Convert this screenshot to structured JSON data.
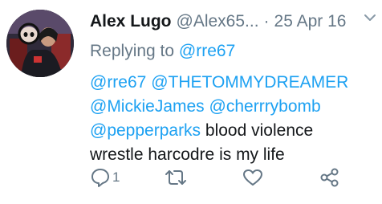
{
  "tweet": {
    "author_name": "Alex Lugo",
    "author_handle": "@Alex65...",
    "separator": "·",
    "timestamp": "25 Apr 16",
    "replying_prefix": "Replying to",
    "replying_to": "@rre67",
    "mentions": [
      "@rre67",
      "@THETOMMYDREAMER",
      "@MickieJames",
      "@cherrrybomb",
      "@pepperparks"
    ],
    "text_line1": "blood violence",
    "text_line2": "wrestle harcodre is my life"
  },
  "actions": {
    "reply_count": "1",
    "icons": [
      "reply-icon",
      "retweet-icon",
      "like-icon",
      "share-icon"
    ]
  },
  "colors": {
    "link": "#1da1f2",
    "muted": "#657786",
    "text": "#14171a"
  }
}
